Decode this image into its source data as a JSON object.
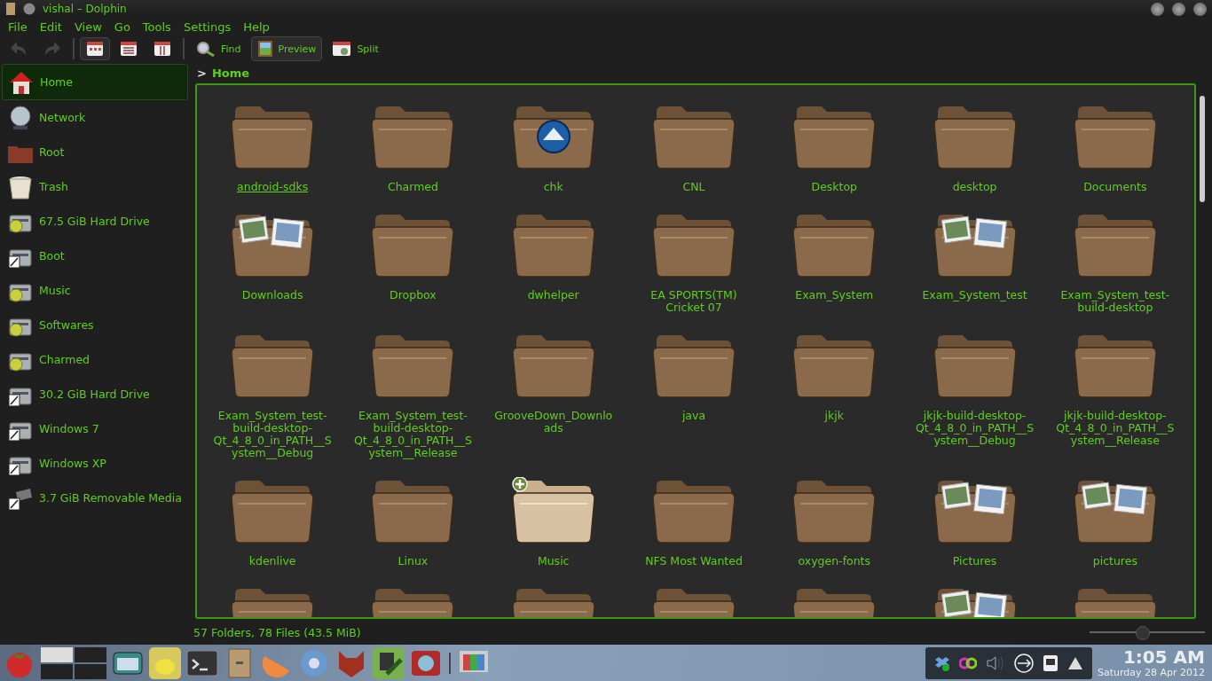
{
  "window": {
    "title": "vishal – Dolphin"
  },
  "menu": [
    "File",
    "Edit",
    "View",
    "Go",
    "Tools",
    "Settings",
    "Help"
  ],
  "toolbar": [
    {
      "kind": "back",
      "disabled": true,
      "selected": false
    },
    {
      "kind": "forward",
      "disabled": true,
      "selected": false
    },
    {
      "kind": "icons-view",
      "selected": true,
      "disabled": false
    },
    {
      "kind": "details-view",
      "selected": false,
      "disabled": false
    },
    {
      "kind": "columns-view",
      "selected": false,
      "disabled": false
    },
    {
      "kind": "find",
      "label": "Find",
      "selected": false,
      "disabled": false
    },
    {
      "kind": "preview",
      "label": "Preview",
      "selected": true,
      "disabled": false
    },
    {
      "kind": "split",
      "label": "Split",
      "selected": false,
      "disabled": false
    }
  ],
  "sidebar": {
    "items": [
      {
        "label": "Home",
        "kind": "home",
        "selected": true
      },
      {
        "label": "Network",
        "kind": "network",
        "selected": false
      },
      {
        "label": "Root",
        "kind": "folder",
        "selected": false
      },
      {
        "label": "Trash",
        "kind": "trash",
        "selected": false
      },
      {
        "label": "67.5 GiB Hard Drive",
        "kind": "mounted-drive",
        "selected": false
      },
      {
        "label": "Boot",
        "kind": "drive",
        "selected": false
      },
      {
        "label": "Music",
        "kind": "mounted-drive",
        "selected": false
      },
      {
        "label": "Softwares",
        "kind": "mounted-drive",
        "selected": false
      },
      {
        "label": "Charmed",
        "kind": "mounted-drive",
        "selected": false
      },
      {
        "label": "30.2 GiB Hard Drive",
        "kind": "drive",
        "selected": false
      },
      {
        "label": "Windows 7",
        "kind": "drive",
        "selected": false
      },
      {
        "label": "Windows XP",
        "kind": "drive",
        "selected": false
      },
      {
        "label": "3.7 GiB Removable Media",
        "kind": "removable",
        "selected": false
      }
    ]
  },
  "breadcrumb": {
    "separator": ">",
    "location": "Home"
  },
  "files": [
    {
      "name": "android-sdks",
      "kind": "folder",
      "selected": false,
      "focused": true
    },
    {
      "name": "Charmed",
      "kind": "folder",
      "selected": false,
      "focused": false
    },
    {
      "name": "chk",
      "kind": "app-folder",
      "selected": false,
      "focused": false
    },
    {
      "name": "CNL",
      "kind": "folder",
      "selected": false,
      "focused": false
    },
    {
      "name": "Desktop",
      "kind": "folder",
      "selected": false,
      "focused": false
    },
    {
      "name": "desktop",
      "kind": "folder",
      "selected": false,
      "focused": false
    },
    {
      "name": "Documents",
      "kind": "folder",
      "selected": false,
      "focused": false
    },
    {
      "name": "Downloads",
      "kind": "photo-folder",
      "selected": false,
      "focused": false
    },
    {
      "name": "Dropbox",
      "kind": "folder",
      "selected": false,
      "focused": false
    },
    {
      "name": "dwhelper",
      "kind": "folder",
      "selected": false,
      "focused": false
    },
    {
      "name": "EA SPORTS(TM) Cricket 07",
      "kind": "folder",
      "selected": false,
      "focused": false
    },
    {
      "name": "Exam_System",
      "kind": "folder",
      "selected": false,
      "focused": false
    },
    {
      "name": "Exam_System_test",
      "kind": "photo-folder",
      "selected": false,
      "focused": false
    },
    {
      "name": "Exam_System_test-build-desktop",
      "kind": "folder",
      "selected": false,
      "focused": false
    },
    {
      "name": "Exam_System_test-build-desktop-Qt_4_8_0_in_PATH__System__Debug",
      "kind": "folder",
      "selected": false,
      "focused": false
    },
    {
      "name": "Exam_System_test-build-desktop-Qt_4_8_0_in_PATH__System__Release",
      "kind": "folder",
      "selected": false,
      "focused": false
    },
    {
      "name": "GrooveDown_Downloads",
      "kind": "folder",
      "selected": false,
      "focused": false
    },
    {
      "name": "java",
      "kind": "folder",
      "selected": false,
      "focused": false
    },
    {
      "name": "jkjk",
      "kind": "folder",
      "selected": false,
      "focused": false
    },
    {
      "name": "jkjk-build-desktop-Qt_4_8_0_in_PATH__System__Debug",
      "kind": "folder",
      "selected": false,
      "focused": false
    },
    {
      "name": "jkjk-build-desktop-Qt_4_8_0_in_PATH__System__Release",
      "kind": "folder",
      "selected": false,
      "focused": false
    },
    {
      "name": "kdenlive",
      "kind": "folder",
      "selected": false,
      "focused": false
    },
    {
      "name": "Linux",
      "kind": "folder",
      "selected": false,
      "focused": false
    },
    {
      "name": "Music",
      "kind": "folder",
      "selected": true,
      "focused": false
    },
    {
      "name": "NFS Most Wanted",
      "kind": "folder",
      "selected": false,
      "focused": false
    },
    {
      "name": "oxygen-fonts",
      "kind": "folder",
      "selected": false,
      "focused": false
    },
    {
      "name": "Pictures",
      "kind": "photo-folder",
      "selected": false,
      "focused": false
    },
    {
      "name": "pictures",
      "kind": "photo-folder",
      "selected": false,
      "focused": false
    }
  ],
  "partial_row": [
    {
      "kind": "folder"
    },
    {
      "kind": "folder"
    },
    {
      "kind": "folder"
    },
    {
      "kind": "folder"
    },
    {
      "kind": "folder"
    },
    {
      "kind": "photo-folder"
    },
    {
      "kind": "folder"
    }
  ],
  "status_bar": {
    "text": "57 Folders, 78 Files (43.5 MiB)",
    "zoom": {
      "level": 0.45
    }
  },
  "taskbar": {
    "clock": {
      "time": "1:05 AM",
      "date": "Saturday 28 Apr 2012"
    }
  }
}
